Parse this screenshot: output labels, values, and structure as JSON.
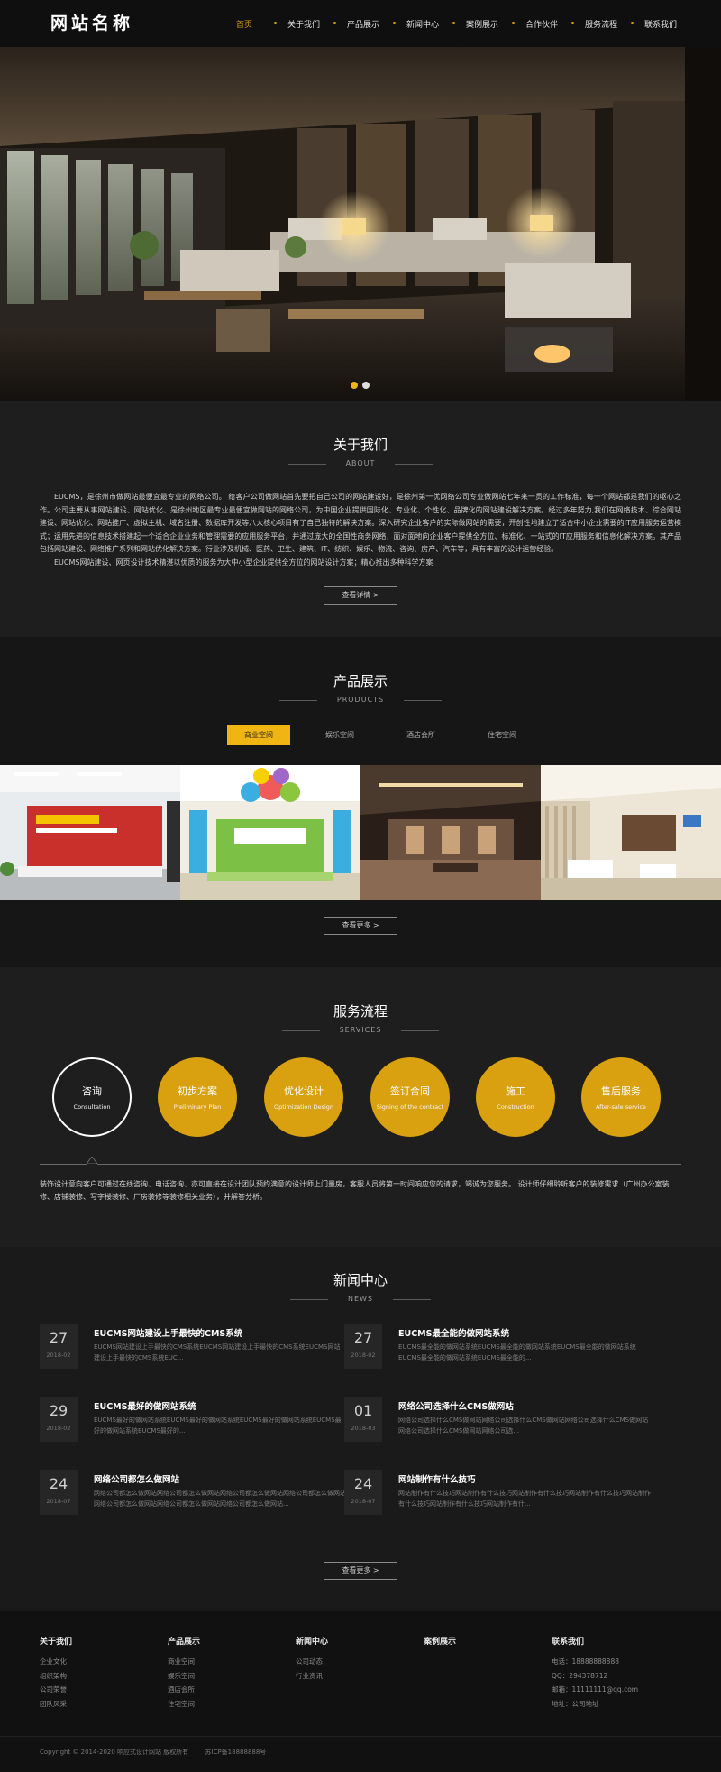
{
  "site": {
    "logo": "网站名称"
  },
  "nav": [
    {
      "label": "首页",
      "active": true
    },
    {
      "label": "关于我们"
    },
    {
      "label": "产品展示"
    },
    {
      "label": "新闻中心"
    },
    {
      "label": "案例展示"
    },
    {
      "label": "合作伙伴"
    },
    {
      "label": "服务流程"
    },
    {
      "label": "联系我们"
    }
  ],
  "hero": {
    "slides": 2,
    "active_slide": 1
  },
  "about": {
    "title": "关于我们",
    "subtitle": "ABOUT",
    "paragraph1": "EUCMS，是徐州市做网站最便宜最专业的网络公司。 给客户公司做网站首先要把自己公司的网站建设好，是徐州第一优网络公司专业做网站七年来一贯的工作标准，每一个网站都是我们的呕心之作。公司主要从事网站建设、网站优化、是徐州地区最专业最便宜做网站的网络公司，为中国企业提供国际化、专业化、个性化、品牌化的网站建设解决方案。经过多年努力,我们在网络技术、综合网站建设、网站优化、网站推广、虚拟主机、域名注册、数据库开发等八大核心项目有了自己独特的解决方案。深入研究企业客户的实际做网站的需要，开创性地建立了适合中小企业需要的IT应用服务运营模式；运用先进的信息技术搭建起一个适合企业业务和管理需要的应用服务平台，并通过庞大的全国性商务网络，面对面地向企业客户提供全方位、标准化、一站式的IT应用服务和信息化解决方案。其产品包括网站建设、网络推广系列和网站优化解决方案。行业涉及机械、医药、卫生、建筑、IT、纺织、娱乐、物流、咨询、房产、汽车等，具有丰富的设计运营经验。",
    "paragraph2": "EUCMS网站建设、网页设计技术精湛以优质的服务为大中小型企业提供全方位的网站设计方案；精心推出多种科学方案",
    "more": "查看详情 >"
  },
  "products": {
    "title": "产品展示",
    "subtitle": "PRODUCTS",
    "tabs": [
      {
        "label": "商业空间",
        "active": true
      },
      {
        "label": "娱乐空间"
      },
      {
        "label": "酒店会所"
      },
      {
        "label": "住宅空间"
      }
    ],
    "more": "查看更多 >"
  },
  "services": {
    "title": "服务流程",
    "subtitle": "SERVICES",
    "steps": [
      {
        "name": "咨询",
        "en": "Consultation"
      },
      {
        "name": "初步方案",
        "en": "Preliminary Plan"
      },
      {
        "name": "优化设计",
        "en": "Optimization Design"
      },
      {
        "name": "签订合同",
        "en": "Signing of the contract"
      },
      {
        "name": "施工",
        "en": "Construction"
      },
      {
        "name": "售后服务",
        "en": "After-sale service"
      }
    ],
    "description": "装饰设计意向客户可通过在线咨询、电话咨询、亦可直接在设计团队预约满意的设计师上门量房，客服人员将第一时间响应您的请求，竭诚为您服务。 设计师仔细聆听客户的装修需求（广州办公室装修、店铺装修、写字楼装修、厂房装修等装修相关业务），并解答分析。"
  },
  "news": {
    "title": "新闻中心",
    "subtitle": "NEWS",
    "items": [
      {
        "day": "27",
        "ym": "2018-02",
        "title": "EUCMS网站建设上手最快的CMS系统",
        "desc": "EUCMS网站建设上手最快的CMS系统EUCMS网站建设上手最快的CMS系统EUCMS网站建设上手最快的CMS系统EUC..."
      },
      {
        "day": "27",
        "ym": "2018-02",
        "title": "EUCMS最全能的做网站系统",
        "desc": "EUCMS最全能的做网站系统EUCMS最全能的做网站系统EUCMS最全能的做网站系统EUCMS最全能的做网站系统EUCMS最全能的..."
      },
      {
        "day": "29",
        "ym": "2018-02",
        "title": "EUCMS最好的做网站系统",
        "desc": "EUCMS最好的做网站系统EUCMS最好的做网站系统EUCMS最好的做网站系统EUCMS最好的做网站系统EUCMS最好的..."
      },
      {
        "day": "01",
        "ym": "2018-03",
        "title": "网络公司选择什么CMS做网站",
        "desc": "网络公司选择什么CMS做网站网络公司选择什么CMS做网站网络公司选择什么CMS做网站网络公司选择什么CMS做网站网络公司选..."
      },
      {
        "day": "24",
        "ym": "2018-07",
        "title": "网络公司都怎么做网站",
        "desc": "网络公司都怎么做网站网络公司都怎么做网站网络公司都怎么做网站网络公司都怎么做网站网络公司都怎么做网站网络公司都怎么做网站网络公司都怎么做网站..."
      },
      {
        "day": "24",
        "ym": "2018-07",
        "title": "网站制作有什么技巧",
        "desc": "网站制作有什么技巧网站制作有什么技巧网站制作有什么技巧网站制作有什么技巧网站制作有什么技巧网站制作有什么技巧网站制作有什..."
      }
    ],
    "more": "查看更多 >"
  },
  "footer": {
    "columns": [
      {
        "title": "关于我们",
        "links": [
          "企业文化",
          "组织架构",
          "公司荣誉",
          "团队风采"
        ]
      },
      {
        "title": "产品展示",
        "links": [
          "商业空间",
          "娱乐空间",
          "酒店会所",
          "住宅空间"
        ]
      },
      {
        "title": "新闻中心",
        "links": [
          "公司动态",
          "行业资讯"
        ]
      },
      {
        "title": "案例展示",
        "links": []
      }
    ],
    "contact": {
      "title": "联系我们",
      "phone": "电话：18888888888",
      "qq": "QQ：294378712",
      "email": "邮箱：11111111@qq.com",
      "address": "地址：公司地址"
    },
    "copyright": "Copyright © 2014-2020 响应式设计网站 版权所有",
    "icp": "苏ICP备18888888号"
  },
  "colors": {
    "accent": "#f0b513",
    "circle": "#d9a00f",
    "bg_dark": "#1c1c1c"
  }
}
